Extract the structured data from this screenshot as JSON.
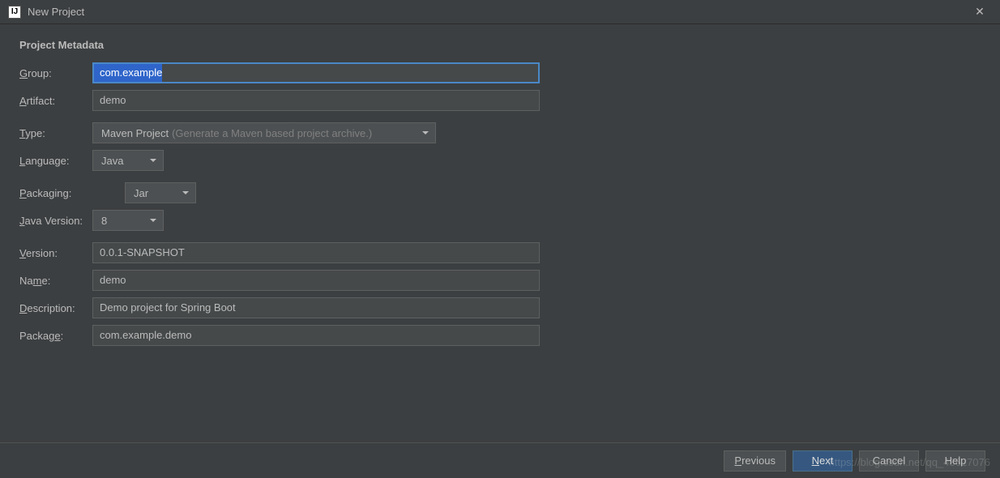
{
  "titlebar": {
    "icon_text": "IJ",
    "title": "New Project",
    "close_glyph": "✕"
  },
  "section_title": "Project Metadata",
  "labels": {
    "group": "Group:",
    "artifact": "Artifact:",
    "type": "Type:",
    "language": "Language:",
    "packaging": "Packaging:",
    "java_version": "Java Version:",
    "version": "Version:",
    "name": "Name:",
    "description": "Description:",
    "package": "Package:"
  },
  "fields": {
    "group": "com.example",
    "artifact": "demo",
    "type_value": "Maven Project",
    "type_hint": "(Generate a Maven based project archive.)",
    "language": "Java",
    "packaging": "Jar",
    "java_version": "8",
    "version": "0.0.1-SNAPSHOT",
    "name": "demo",
    "description": "Demo project for Spring Boot",
    "package": "com.example.demo"
  },
  "buttons": {
    "previous": "Previous",
    "next": "Next",
    "cancel": "Cancel",
    "help": "Help"
  },
  "watermark": "https://blog.csdn.net/qq_43627076"
}
